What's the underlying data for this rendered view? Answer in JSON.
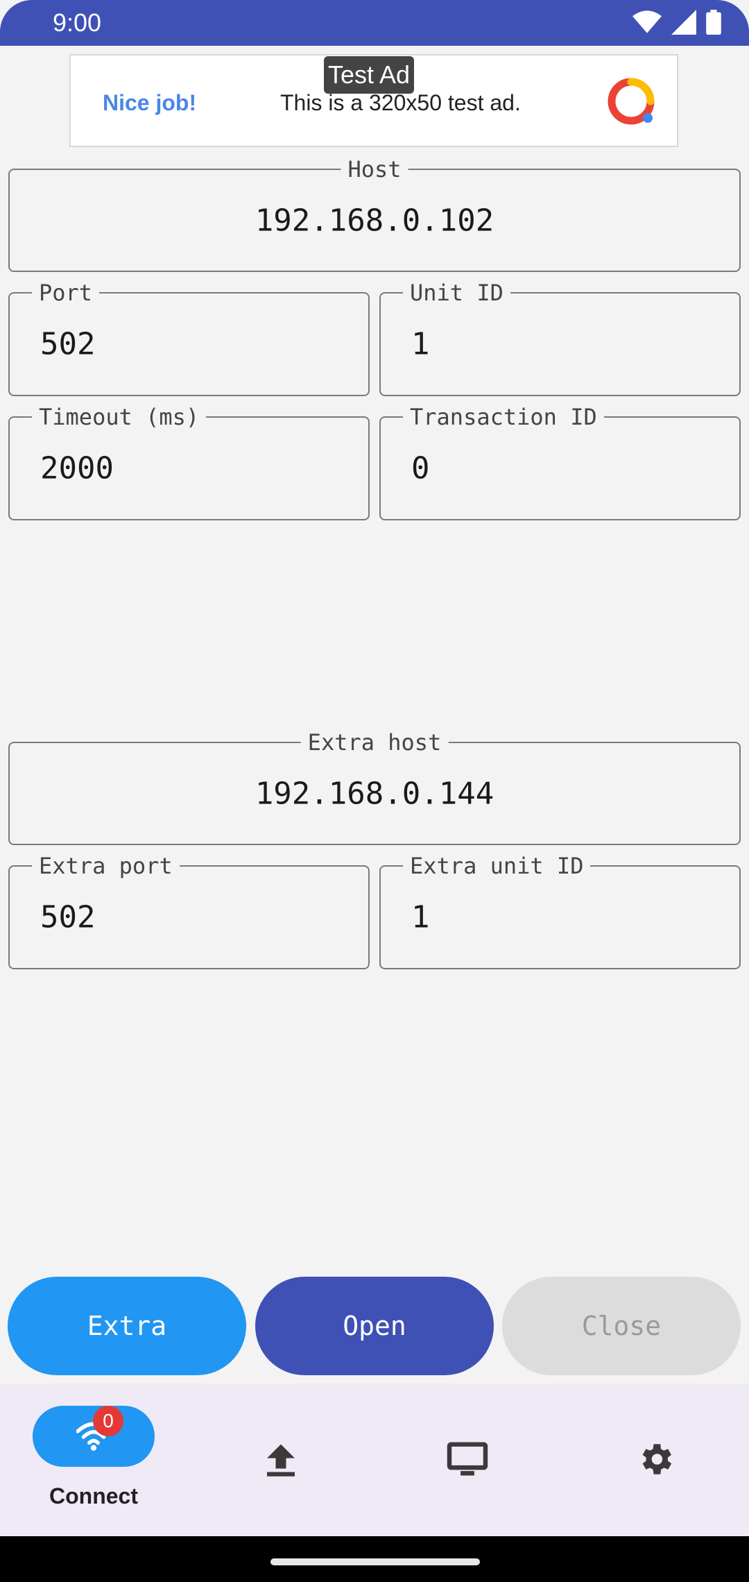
{
  "status_bar": {
    "time": "9:00"
  },
  "ad": {
    "badge": "Test Ad",
    "headline": "Nice job!",
    "text": "This is a 320x50 test ad."
  },
  "fields": {
    "host": {
      "label": "Host",
      "value": "192.168.0.102"
    },
    "port": {
      "label": "Port",
      "value": "502"
    },
    "unit_id": {
      "label": "Unit ID",
      "value": "1"
    },
    "timeout": {
      "label": "Timeout (ms)",
      "value": "2000"
    },
    "transaction_id": {
      "label": "Transaction ID",
      "value": "0"
    },
    "extra_host": {
      "label": "Extra host",
      "value": "192.168.0.144"
    },
    "extra_port": {
      "label": "Extra port",
      "value": "502"
    },
    "extra_unit_id": {
      "label": "Extra unit ID",
      "value": "1"
    }
  },
  "buttons": {
    "extra": {
      "label": "Extra",
      "color": "#2196f3"
    },
    "open": {
      "label": "Open",
      "color": "#3f51b5"
    },
    "close": {
      "label": "Close",
      "color": "#dcdcdc",
      "disabled": true
    }
  },
  "bottom_nav": {
    "items": [
      {
        "label": "Connect",
        "icon": "wifi-icon",
        "badge": "0",
        "selected": true
      },
      {
        "label": "",
        "icon": "upload-icon"
      },
      {
        "label": "",
        "icon": "monitor-icon"
      },
      {
        "label": "",
        "icon": "settings-icon"
      }
    ]
  }
}
